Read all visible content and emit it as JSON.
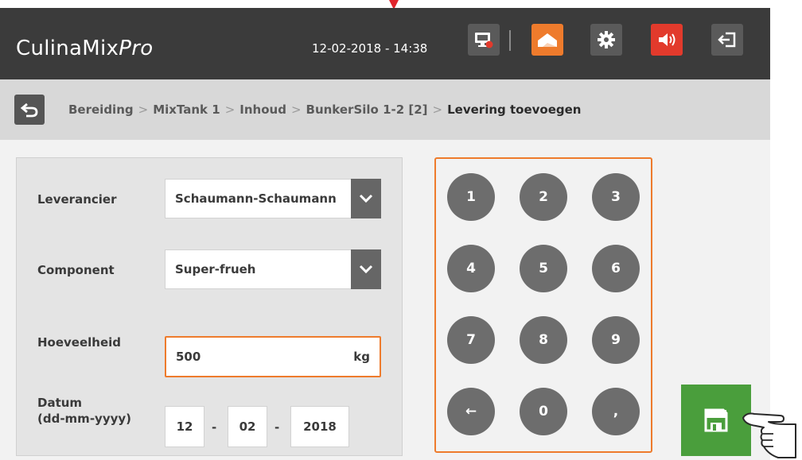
{
  "app": {
    "title_main": "CulinaMix",
    "title_suffix": "Pro",
    "datetime": "12-02-2018 - 14:38"
  },
  "header_icons": {
    "monitor": "monitor-icon",
    "home": "home-icon",
    "settings": "gear-icon",
    "sound": "speaker-icon",
    "logout": "logout-icon",
    "accent_orange": "#ee7b2c",
    "accent_red": "#e23a2c"
  },
  "breadcrumb": {
    "items": [
      "Bereiding",
      "MixTank 1",
      "Inhoud",
      "BunkerSilo 1-2 [2]"
    ],
    "current": "Levering toevoegen",
    "separator": ">"
  },
  "form": {
    "supplier_label": "Leverancier",
    "supplier_value": "Schaumann-Schaumann",
    "component_label": "Component",
    "component_value": "Super-frueh",
    "quantity_label": "Hoeveelheid",
    "quantity_value": "500",
    "quantity_unit": "kg",
    "date_label_line1": "Datum",
    "date_label_line2": "(dd-mm-yyyy)",
    "date_day": "12",
    "date_month": "02",
    "date_year": "2018",
    "date_separator": "-"
  },
  "keypad": {
    "keys": [
      "1",
      "2",
      "3",
      "4",
      "5",
      "6",
      "7",
      "8",
      "9",
      "←",
      "0",
      ","
    ]
  },
  "actions": {
    "save": "save-icon",
    "save_color": "#4a9e3c"
  }
}
